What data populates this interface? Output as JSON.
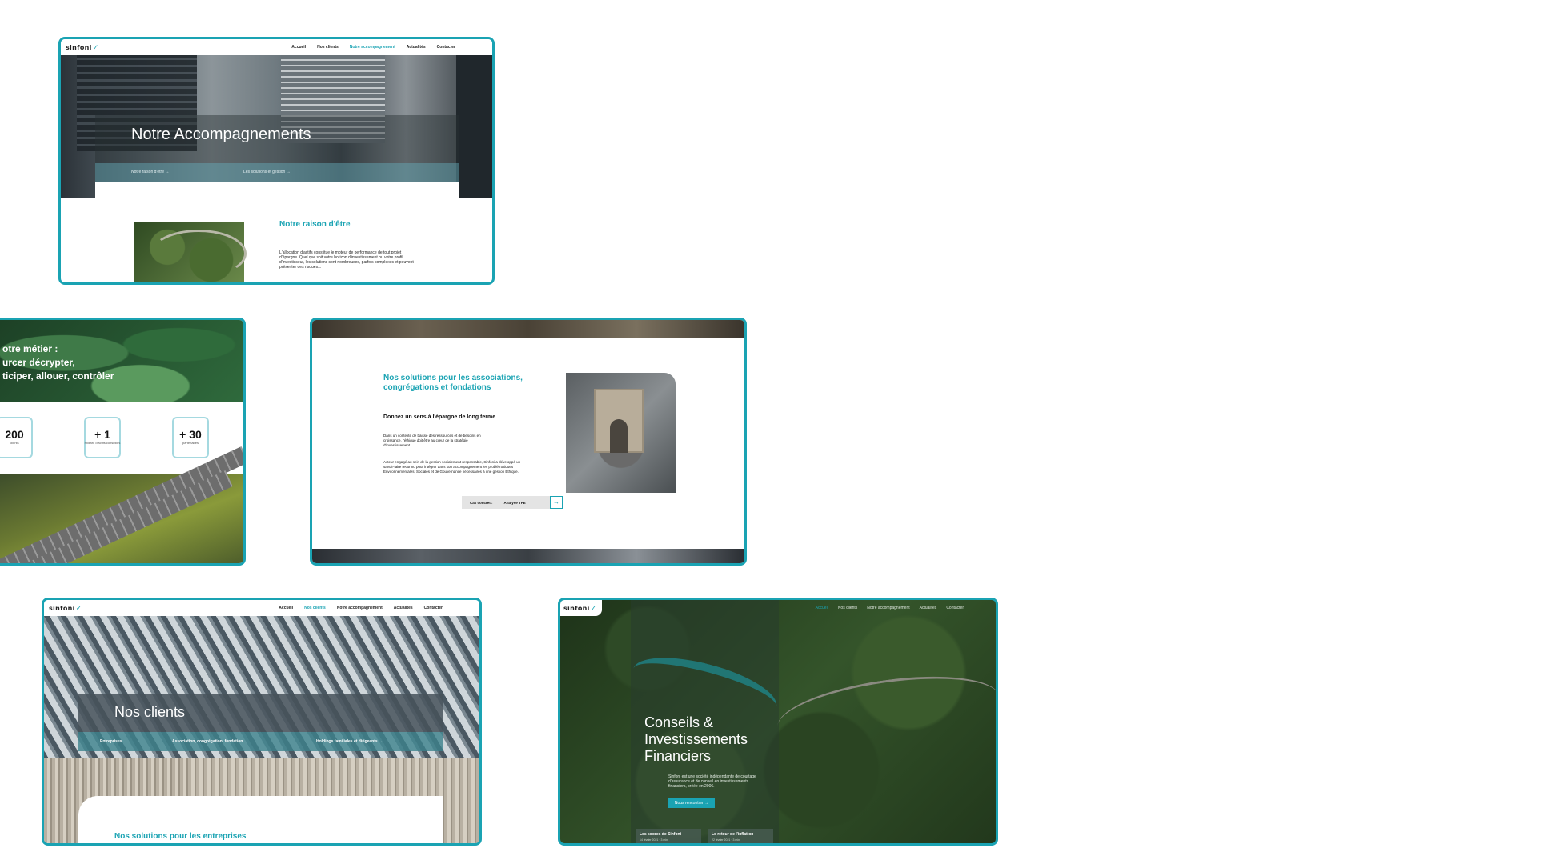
{
  "brand": {
    "logo": "sinfoni",
    "accent": "#1aa3b3"
  },
  "card1": {
    "nav": [
      "Accueil",
      "Nos clients",
      "Notre accompagnement",
      "Actualités",
      "Contacter"
    ],
    "active_nav": 2,
    "hero_title": "Notre Accompagnements",
    "sub1": "Notre raison d'être",
    "sub2": "Les solutions et gestion",
    "section_title": "Notre raison d'être",
    "section_text": "L'allocation d'actifs constitue le moteur de performance de tout projet d'épargne. Quel que soit votre horizon d'investissement ou votre profil d'investisseur, les solutions sont nombreuses, parfois complexes et peuvent présenter des risques..."
  },
  "card2": {
    "heading_line1": "otre métier :",
    "heading_line2": "urcer décrypter,",
    "heading_line3": "ticiper, allouer, contrôler",
    "stats": [
      {
        "value": "200",
        "label": "clients"
      },
      {
        "value": "+ 1",
        "label": "milliard d'actifs conseillés"
      },
      {
        "value": "+ 30",
        "label": "partenaires"
      }
    ]
  },
  "card3": {
    "title": "Nos solutions pour les associations, congrégations et fondations",
    "subtitle": "Donnez un sens à l'épargne de long terme",
    "p1": "Dans un contexte de baisse des ressources et de besoins en croissance, l'éthique doit être au cœur de la stratégie d'investissement",
    "p2": "Acteur engagé au sein de la gestion socialement responsable, Sinfoni a développé un savoir-faire reconnu pour intégrer dans son accompagnement les problématiques Environnementales, Sociales et de Gouvernance nécessaires à une gestion Éthique.",
    "case_label": "Cas concret :",
    "case_value": "Analyse TPE",
    "case_arrow": "→"
  },
  "card4": {
    "nav": [
      "Accueil",
      "Nos clients",
      "Notre accompagnement",
      "Actualités",
      "Contacter"
    ],
    "active_nav": 1,
    "hero_title": "Nos clients",
    "tab1": "Entreprises →",
    "tab2": "Association, congrégation, fondation →",
    "tab3": "Holdings familiales et dirigeants →",
    "section_title": "Nos solutions pour les entreprises"
  },
  "card5": {
    "nav": [
      "Accueil",
      "Nos clients",
      "Notre accompagnement",
      "Actualités",
      "Contacter"
    ],
    "active_nav": 0,
    "hero_title": "Conseils & Investissements Financiers",
    "hero_text": "Sinfoni est une société indépendante de courtage d'assurance et de conseil en investissements financiers, créée en 2006.",
    "cta": "Nous rencontrer →",
    "news": [
      {
        "title": "Les soores de Sinfoni",
        "date": "14 février 2021",
        "time": "3 min"
      },
      {
        "title": "Le retour de l'inflation",
        "date": "22 février 2021",
        "time": "3 min"
      }
    ]
  }
}
